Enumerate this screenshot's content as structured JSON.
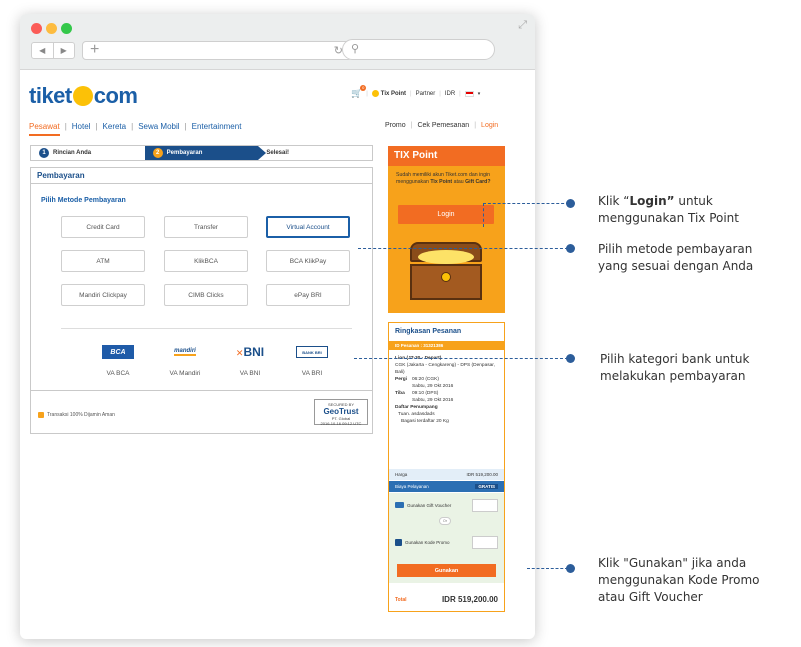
{
  "browser": {
    "url_plus": "+",
    "search_icon": "search-icon"
  },
  "header": {
    "logo_left": "tiket",
    "logo_right": "com",
    "cart_count": "0",
    "tix_point": "Tix Point",
    "partner": "Partner",
    "currency": "IDR"
  },
  "nav": {
    "items": [
      "Pesawat",
      "Hotel",
      "Kereta",
      "Sewa Mobil",
      "Entertainment"
    ],
    "right": [
      "Promo",
      "Cek Pemesanan",
      "Login"
    ]
  },
  "steps": [
    {
      "num": "1",
      "label": "Rincian Anda"
    },
    {
      "num": "2",
      "label": "Pembayaran"
    },
    {
      "num": "",
      "label": "Selesai!"
    }
  ],
  "payment": {
    "title": "Pembayaran",
    "subtitle": "Pilih Metode Pembayaran",
    "methods": [
      "Credit Card",
      "Transfer",
      "Virtual Account",
      "ATM",
      "KlikBCA",
      "BCA KlikPay",
      "Mandiri Clickpay",
      "CIMB Clicks",
      "ePay BRI"
    ],
    "selected_method": "Virtual Account",
    "banks": [
      {
        "logo": "BCA",
        "label": "VA BCA"
      },
      {
        "logo": "mandiri",
        "label": "VA Mandiri"
      },
      {
        "logo": "BNI",
        "label": "VA BNI"
      },
      {
        "logo": "BANK BRI",
        "label": "VA BRI"
      }
    ],
    "secure_text": "Transaksi 100% Dijamin Aman",
    "geotrust_top": "SECURED BY",
    "geotrust_brand": "GeoTrust",
    "geotrust_sub": "PT. Global",
    "geotrust_date": "2016-10-16 09:12 UTC"
  },
  "tix": {
    "title": "TIX Point",
    "text_1": "Sudah memiliki akun Tiket.com dan ingin menggunakan ",
    "text_bold_1": "Tix Point",
    "text_2": " atau ",
    "text_bold_2": "Gift Card?",
    "login_label": "Login"
  },
  "summary": {
    "title": "Ringkasan Pesanan",
    "order_id": "ID Pesanan : 31321386",
    "flight": "Lion (JT-30 - Depart)",
    "route": "CGK (Jakarta - Cengkareng) - DPS (Denpasar, Bali)",
    "depart_label": "Pergi",
    "depart_time": "06:20 (CGK)",
    "depart_date": "Sabtu, 29 Okt 2016",
    "arrive_label": "Tiba",
    "arrive_time": "09:10 (DPS)",
    "arrive_date": "Sabtu, 29 Okt 2016",
    "passenger_header": "Daftar Penumpang",
    "passenger": "Tuan. asdasdads",
    "baggage": "Bagasi terdaftar 20 Kg",
    "price_label": "Harga",
    "price_value": "IDR 519,200.00",
    "fee_label": "Biaya Pelayanan",
    "fee_value": "GRATIS",
    "voucher_label": "Gunakan Gift Voucher",
    "or": "Or",
    "promo_label": "Gunakan Kode Promo",
    "use_label": "Gunakan",
    "total_label": "Total",
    "total_value": "IDR 519,200.00"
  },
  "callouts": {
    "c1_pre": "Klik “",
    "c1_bold": "Login”",
    "c1_post": " untuk menggunakan Tix Point",
    "c2": "Pilih metode pembayaran yang sesuai dengan Anda",
    "c3": "Pilih kategori bank untuk melakukan pembayaran",
    "c4": "Klik \"Gunakan\" jika anda menggunakan Kode Promo atau Gift Voucher"
  },
  "colors": {
    "brand_blue": "#1b5fa7",
    "orange": "#f26c22",
    "yellow": "#f7a21b",
    "callout_line": "#2c5d9a"
  }
}
